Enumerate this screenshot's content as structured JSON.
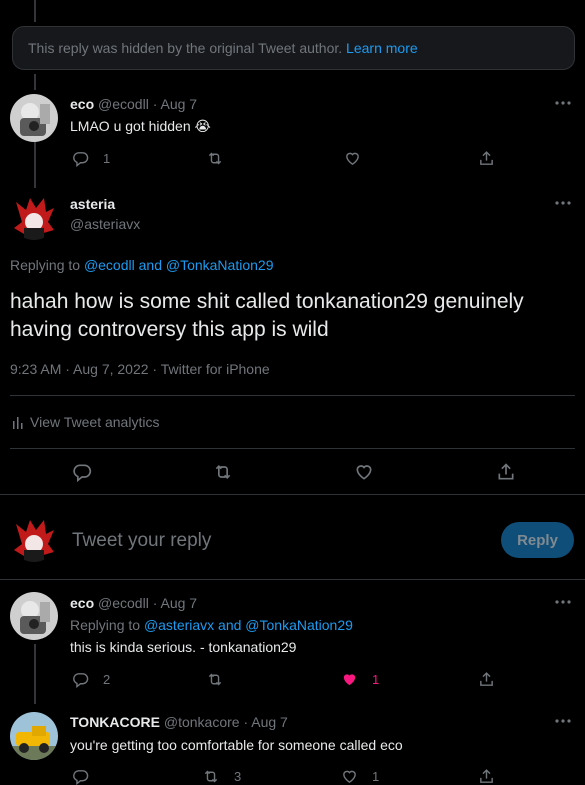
{
  "hidden_notice": {
    "text": "This reply was hidden by the original Tweet author.",
    "link": "Learn more"
  },
  "tweet1": {
    "name": "eco",
    "handle": "@ecodll",
    "sep": "·",
    "date": "Aug 7",
    "text": "LMAO u got hidden 😭",
    "reply_count": "1"
  },
  "main": {
    "name": "asteria",
    "handle": "@asteriavx",
    "replying_prefix": "Replying to",
    "replying_users": "@ecodll and @TonkaNation29",
    "text": "hahah how is some shit called tonkanation29 genuinely having controversy this app is wild",
    "meta": "9:23 AM · Aug 7, 2022 · Twitter for iPhone",
    "analytics": "View Tweet analytics"
  },
  "compose": {
    "placeholder": "Tweet your reply",
    "button": "Reply"
  },
  "tweet2": {
    "name": "eco",
    "handle": "@ecodll",
    "sep": "·",
    "date": "Aug 7",
    "replying_prefix": "Replying to",
    "replying_users": "@asteriavx and @TonkaNation29",
    "text": "this is kinda serious. - tonkanation29",
    "reply_count": "2",
    "like_count": "1"
  },
  "tweet3": {
    "name": "TONKACORE",
    "handle": "@tonkacore",
    "sep": "·",
    "date": "Aug 7",
    "text": "you're getting too comfortable for someone called eco",
    "retweet_count": "3",
    "like_count": "1"
  },
  "colors": {
    "link": "#1d9bf0",
    "like_active": "#f91880",
    "muted": "#71767b"
  }
}
